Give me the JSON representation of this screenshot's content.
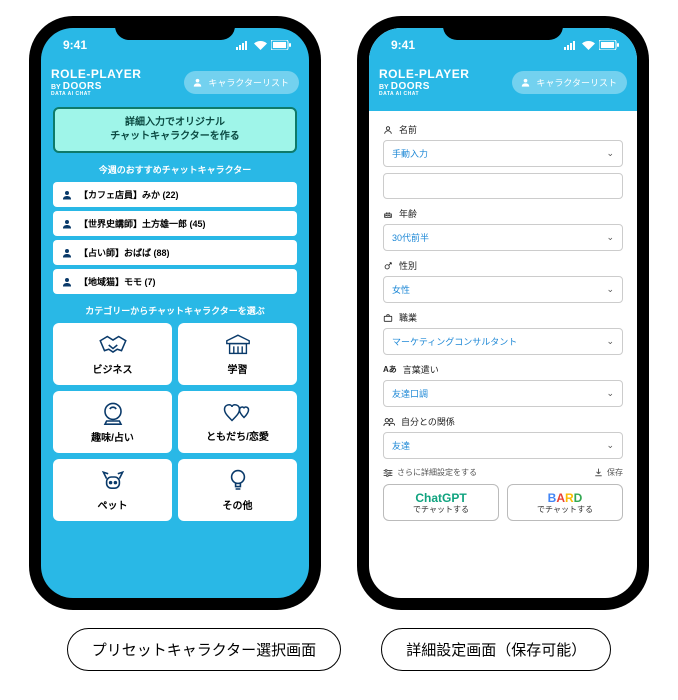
{
  "status": {
    "time": "9:41"
  },
  "logo": {
    "line1": "ROLE-PLAYER",
    "line2_by": "BY",
    "line2_brand": "DOORS",
    "line3": "DATA AI CHAT"
  },
  "char_list_button": "キャラクターリスト",
  "phone_left": {
    "create_button_l1": "詳細入力でオリジナル",
    "create_button_l2": "チャットキャラクターを作る",
    "recommend_title": "今週のおすすめチャットキャラクター",
    "recommend": [
      {
        "label": "【カフェ店員】みか (22)"
      },
      {
        "label": "【世界史講師】土方雄一郎 (45)"
      },
      {
        "label": "【占い師】おばば (88)"
      },
      {
        "label": "【地域猫】モモ (7)"
      }
    ],
    "category_title": "カテゴリーからチャットキャラクターを選ぶ",
    "categories": [
      {
        "id": "business",
        "label": "ビジネス"
      },
      {
        "id": "study",
        "label": "学習"
      },
      {
        "id": "hobby",
        "label": "趣味/占い"
      },
      {
        "id": "friend",
        "label": "ともだち/恋愛"
      },
      {
        "id": "pet",
        "label": "ペット"
      },
      {
        "id": "other",
        "label": "その他"
      }
    ]
  },
  "phone_right": {
    "fields": {
      "name": {
        "label": "名前",
        "value": "手動入力"
      },
      "age": {
        "label": "年齢",
        "value": "30代前半"
      },
      "gender": {
        "label": "性別",
        "value": "女性"
      },
      "job": {
        "label": "職業",
        "value": "マーケティングコンサルタント"
      },
      "tone": {
        "label": "言葉遣い",
        "value": "友達口調"
      },
      "relation": {
        "label": "自分との関係",
        "value": "友達"
      }
    },
    "more_settings": "さらに詳細設定をする",
    "save": "保存",
    "chat_buttons": {
      "gpt": {
        "brand": "ChatGPT",
        "sub": "でチャットする"
      },
      "bard": {
        "brand": "BARD",
        "sub": "でチャットする"
      }
    }
  },
  "captions": {
    "left": "プリセットキャラクター選択画面",
    "right": "詳細設定画面（保存可能）"
  }
}
